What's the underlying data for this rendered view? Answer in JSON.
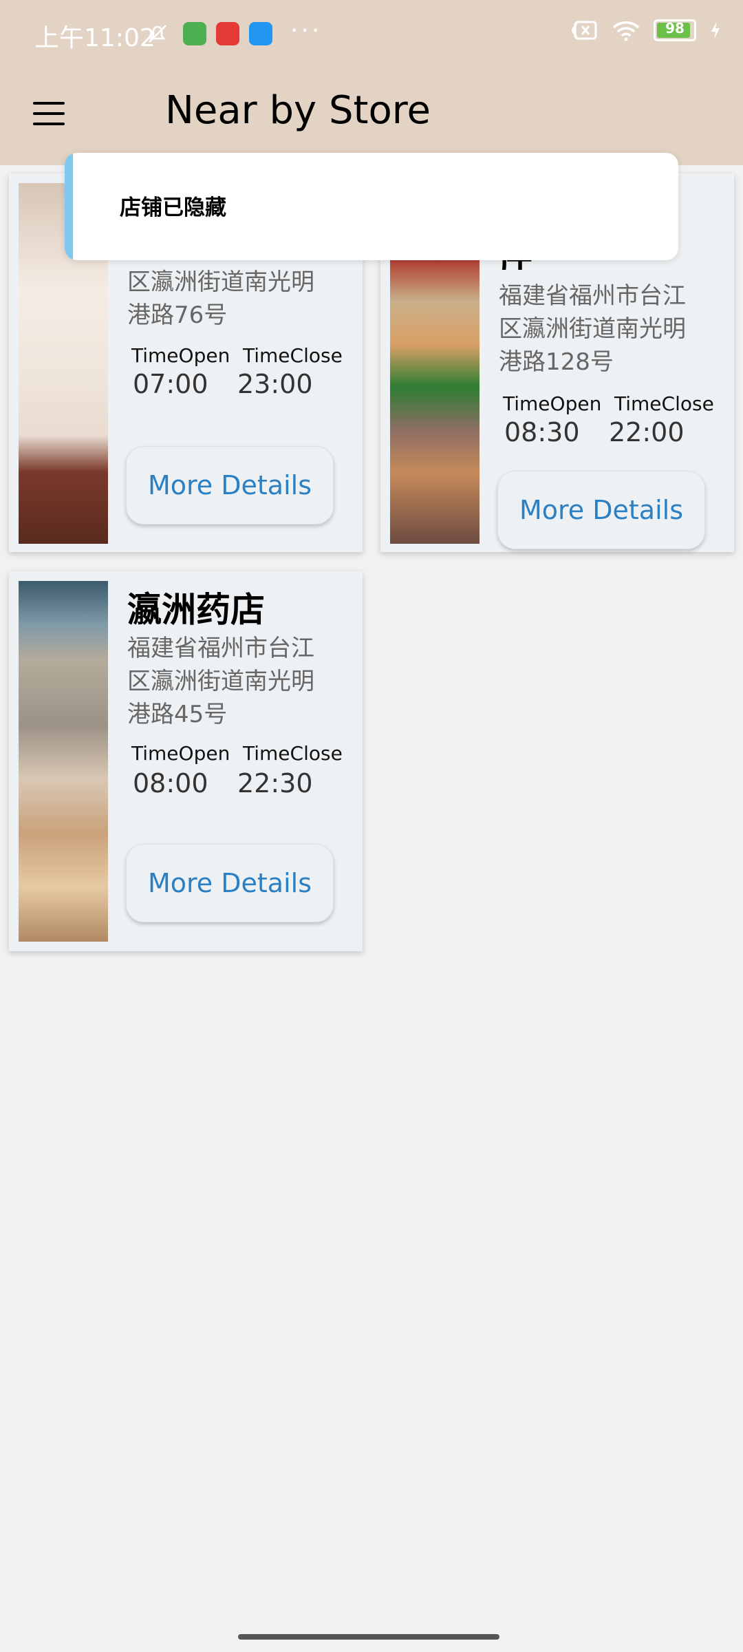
{
  "status_bar": {
    "time": "上午11:02",
    "battery": "98",
    "battery_level": 0.98,
    "icons": [
      "mute-bell-icon",
      "android-app-icon",
      "xiaohongshu-icon",
      "message-app-icon",
      "more-dots-icon",
      "no-sim-icon",
      "wifi-icon",
      "battery-icon",
      "charging-icon"
    ]
  },
  "app_bar": {
    "menu_icon": "hamburger-menu-icon",
    "title": "Near by Store"
  },
  "toast": {
    "message": "店铺已隐藏"
  },
  "stores": [
    {
      "name": "",
      "address": "区瀛洲街道南光明港路76号",
      "open_label": "TimeOpen",
      "open_time": "07:00",
      "close_label": "TimeClose",
      "close_time": "23:00",
      "button": "More Details"
    },
    {
      "name": "厅",
      "address": "福建省福州市台江区瀛洲街道南光明港路128号",
      "open_label": "TimeOpen",
      "open_time": "08:30",
      "close_label": "TimeClose",
      "close_time": "22:00",
      "button": "More Details"
    },
    {
      "name": "瀛洲药店",
      "address": "福建省福州市台江区瀛洲街道南光明港路45号",
      "open_label": "TimeOpen",
      "open_time": "08:00",
      "close_label": "TimeClose",
      "close_time": "22:30",
      "button": "More Details"
    }
  ],
  "colors": {
    "app_bar": "#e3d3c4",
    "background": "#f1f1f1",
    "card": "#eef1f3",
    "button_text": "#2b7fc3",
    "toast_accent": "#80c7f2"
  }
}
